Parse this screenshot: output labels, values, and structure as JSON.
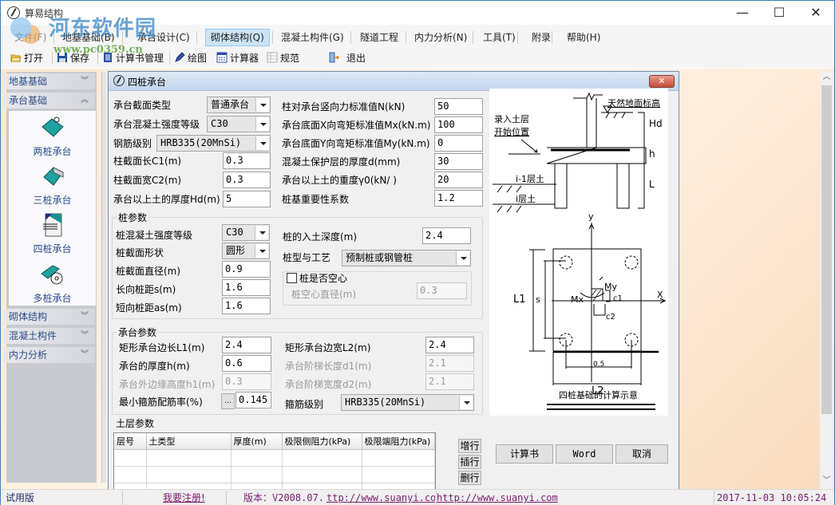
{
  "window": {
    "title": "算易结构",
    "controls": {
      "minimize": "—",
      "maximize": "☐",
      "close": "✕"
    }
  },
  "watermark": {
    "name": "河东软件园",
    "url": "www.pc0359.cn"
  },
  "menubar": {
    "items": [
      {
        "label": "文件(F)"
      },
      {
        "label": "地基基础(B)"
      },
      {
        "label": "承台设计(C)"
      },
      {
        "label": "砌体结构(Q)",
        "active": true
      },
      {
        "label": "混凝土构件(G)"
      },
      {
        "label": "隧道工程"
      },
      {
        "label": "内力分析(N)"
      },
      {
        "label": "工具(T)"
      },
      {
        "label": "附录"
      },
      {
        "label": "帮助(H)"
      }
    ]
  },
  "toolbar": {
    "items": [
      {
        "label": "打开",
        "icon": "folder-open-icon"
      },
      {
        "label": "保存",
        "icon": "save-icon"
      },
      {
        "label": "计算书管理",
        "icon": "book-icon"
      },
      {
        "label": "绘图",
        "icon": "pen-icon"
      },
      {
        "label": "计算器",
        "icon": "calculator-icon"
      },
      {
        "label": "规范",
        "icon": "table-icon"
      },
      {
        "label": "退出",
        "icon": "exit-icon"
      }
    ]
  },
  "sidebar": {
    "sections": [
      {
        "label": "地基基础",
        "state": "collapsed"
      },
      {
        "label": "承台基础",
        "state": "expanded"
      },
      {
        "label": "砌体结构",
        "state": "collapsed"
      },
      {
        "label": "混凝土构件",
        "state": "collapsed"
      },
      {
        "label": "内力分析",
        "state": "collapsed"
      }
    ],
    "tools": [
      {
        "label": "两桩承台"
      },
      {
        "label": "三桩承台"
      },
      {
        "label": "四桩承台"
      },
      {
        "label": "多桩承台"
      }
    ]
  },
  "dialog": {
    "title": "四桩承台",
    "close_label": "✕",
    "top_left": {
      "section_type": {
        "label": "承台截面类型",
        "value": "普通承台"
      },
      "concrete_grade": {
        "label": "承台混凝土强度等级",
        "value": "C30"
      },
      "rebar_grade": {
        "label": "钢筋级别",
        "value": "HRB335(20MnSi)"
      },
      "col_length": {
        "label": "柱截面长C1(m)",
        "value": "0.3"
      },
      "col_width": {
        "label": "柱截面宽C2(m)",
        "value": "0.3"
      },
      "soil_thickness": {
        "label": "承台以上土的厚度Hd(m)",
        "value": "5"
      }
    },
    "top_right": {
      "axial_force": {
        "label": "柱对承台竖向力标准值N(kN)",
        "value": "50"
      },
      "moment_x": {
        "label": "承台底面X向弯矩标准值Mx(kN.m)",
        "value": "100"
      },
      "moment_y": {
        "label": "承台底面Y向弯矩标准值My(kN.m)",
        "value": "0"
      },
      "cover": {
        "label": "混凝土保护层的厚度d(mm)",
        "value": "30"
      },
      "soil_weight": {
        "label": "承台以上土的重度γ0(kN/  )",
        "value": "20"
      },
      "importance": {
        "label": "桩基重要性系数",
        "value": "1.2"
      }
    },
    "pile": {
      "title": "桩参数",
      "concrete_grade": {
        "label": "桩混凝土强度等级",
        "value": "C30"
      },
      "shape": {
        "label": "桩截面形状",
        "value": "圆形"
      },
      "diameter": {
        "label": "桩截面直径(m)",
        "value": "0.9"
      },
      "spacing_long": {
        "label": "长向桩距s(m)",
        "value": "1.6"
      },
      "spacing_short": {
        "label": "短向桩距as(m)",
        "value": "1.6"
      },
      "depth": {
        "label": "桩的入土深度(m)",
        "value": "2.4"
      },
      "type": {
        "label": "桩型与工艺",
        "value": "预制桩或钢管桩"
      },
      "hollow": {
        "label": "桩是否空心",
        "checked": false
      },
      "hollow_diameter": {
        "label": "桩空心直径(m)",
        "value": "0.3"
      }
    },
    "cap": {
      "title": "承台参数",
      "length_l1": {
        "label": "矩形承台边长L1(m)",
        "value": "2.4"
      },
      "thickness": {
        "label": "承台的厚度h(m)",
        "value": "0.6"
      },
      "edge_height": {
        "label": "承台外边缘高度h1(m)",
        "value": "0.3"
      },
      "min_ratio": {
        "label": "最小箍筋配筋率(%)",
        "value": "0.145",
        "button": "..."
      },
      "width_l2": {
        "label": "矩形承台边宽L2(m)",
        "value": "2.4"
      },
      "step_length": {
        "label": "承台阶梯长度d1(m)",
        "value": "2.1"
      },
      "step_width": {
        "label": "承台阶梯宽度d2(m)",
        "value": "2.1"
      },
      "stirrup_grade": {
        "label": "箍筋级别",
        "value": "HRB335(20MnSi)"
      }
    },
    "soil": {
      "title": "土层参数",
      "columns": [
        "层号",
        "土类型",
        "厚度(m)",
        "极限侧阻力(kPa)",
        "极限端阻力(kPa)"
      ],
      "rows": [
        [
          "",
          "",
          "",
          "",
          ""
        ],
        [
          "",
          "",
          "",
          "",
          ""
        ],
        [
          "",
          "",
          "",
          "",
          ""
        ]
      ],
      "buttons": {
        "add": "增行",
        "insert": "插行",
        "delete": "删行"
      }
    },
    "diagram": {
      "ground_label": "天然地面标高",
      "entry_label_1": "录入土层",
      "entry_label_2": "开始位置",
      "hd": "Hd",
      "h": "h",
      "L": "L",
      "layer_prev": "i-1层土",
      "layer_i": "i层土",
      "axis_x": "X",
      "axis_y": "y",
      "mx": "Mx",
      "my": "My",
      "c1": "c1",
      "c2": "c2",
      "l1": "L1",
      "s": "s",
      "l2": "L2",
      "dim_05": "0.5",
      "caption": "四桩基础的计算示意"
    },
    "actions": {
      "report": "计算书",
      "word": "Word",
      "cancel": "取消"
    }
  },
  "statusbar": {
    "edition": "试用版",
    "register": "我要注册!",
    "version": "版本：V2008.07.",
    "link1": "ttp://www.suanyi.co",
    "link2": "http://www.suanyi.com",
    "datetime": "2017-11-03 10:05:24"
  }
}
